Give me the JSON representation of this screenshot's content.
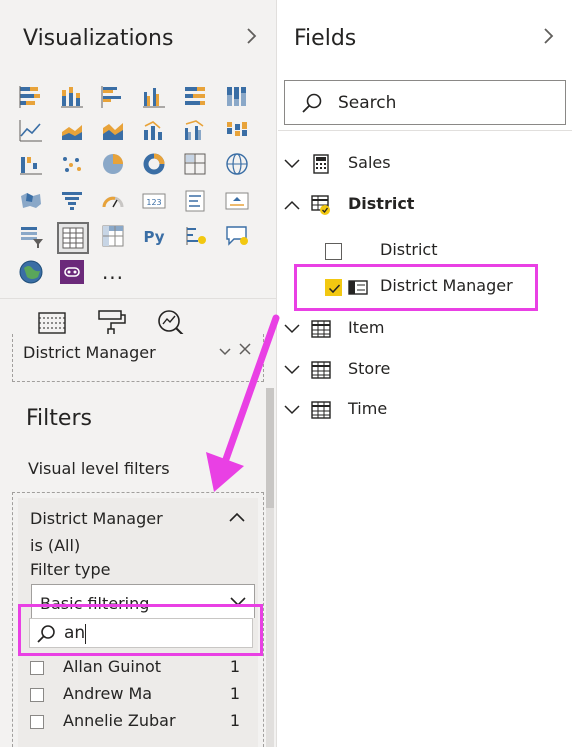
{
  "visualizations": {
    "title": "Visualizations",
    "more_label": "...",
    "field_well_value": "District Manager"
  },
  "filters": {
    "title": "Filters",
    "visual_level_label": "Visual level filters",
    "card": {
      "field_name": "District Manager",
      "summary": "is (All)",
      "filter_type_label": "Filter type",
      "filter_type_value": "Basic filtering",
      "search_value": "an",
      "items": [
        {
          "label": "Allan Guinot",
          "count": "1"
        },
        {
          "label": "Andrew Ma",
          "count": "1"
        },
        {
          "label": "Annelie Zubar",
          "count": "1"
        }
      ]
    }
  },
  "fields": {
    "title": "Fields",
    "search_placeholder": "Search",
    "tables": [
      {
        "name": "Sales",
        "expanded": false
      },
      {
        "name": "District",
        "expanded": true,
        "bold": true
      },
      {
        "name": "Item",
        "expanded": false
      },
      {
        "name": "Store",
        "expanded": false
      },
      {
        "name": "Time",
        "expanded": false
      }
    ],
    "district_fields": [
      {
        "label": "District",
        "checked": false
      },
      {
        "label": "District Manager",
        "checked": true
      }
    ]
  },
  "colors": {
    "accent_yellow": "#f2c811",
    "highlight_magenta": "#e940e4",
    "pane_bg": "#f3f2f1"
  }
}
